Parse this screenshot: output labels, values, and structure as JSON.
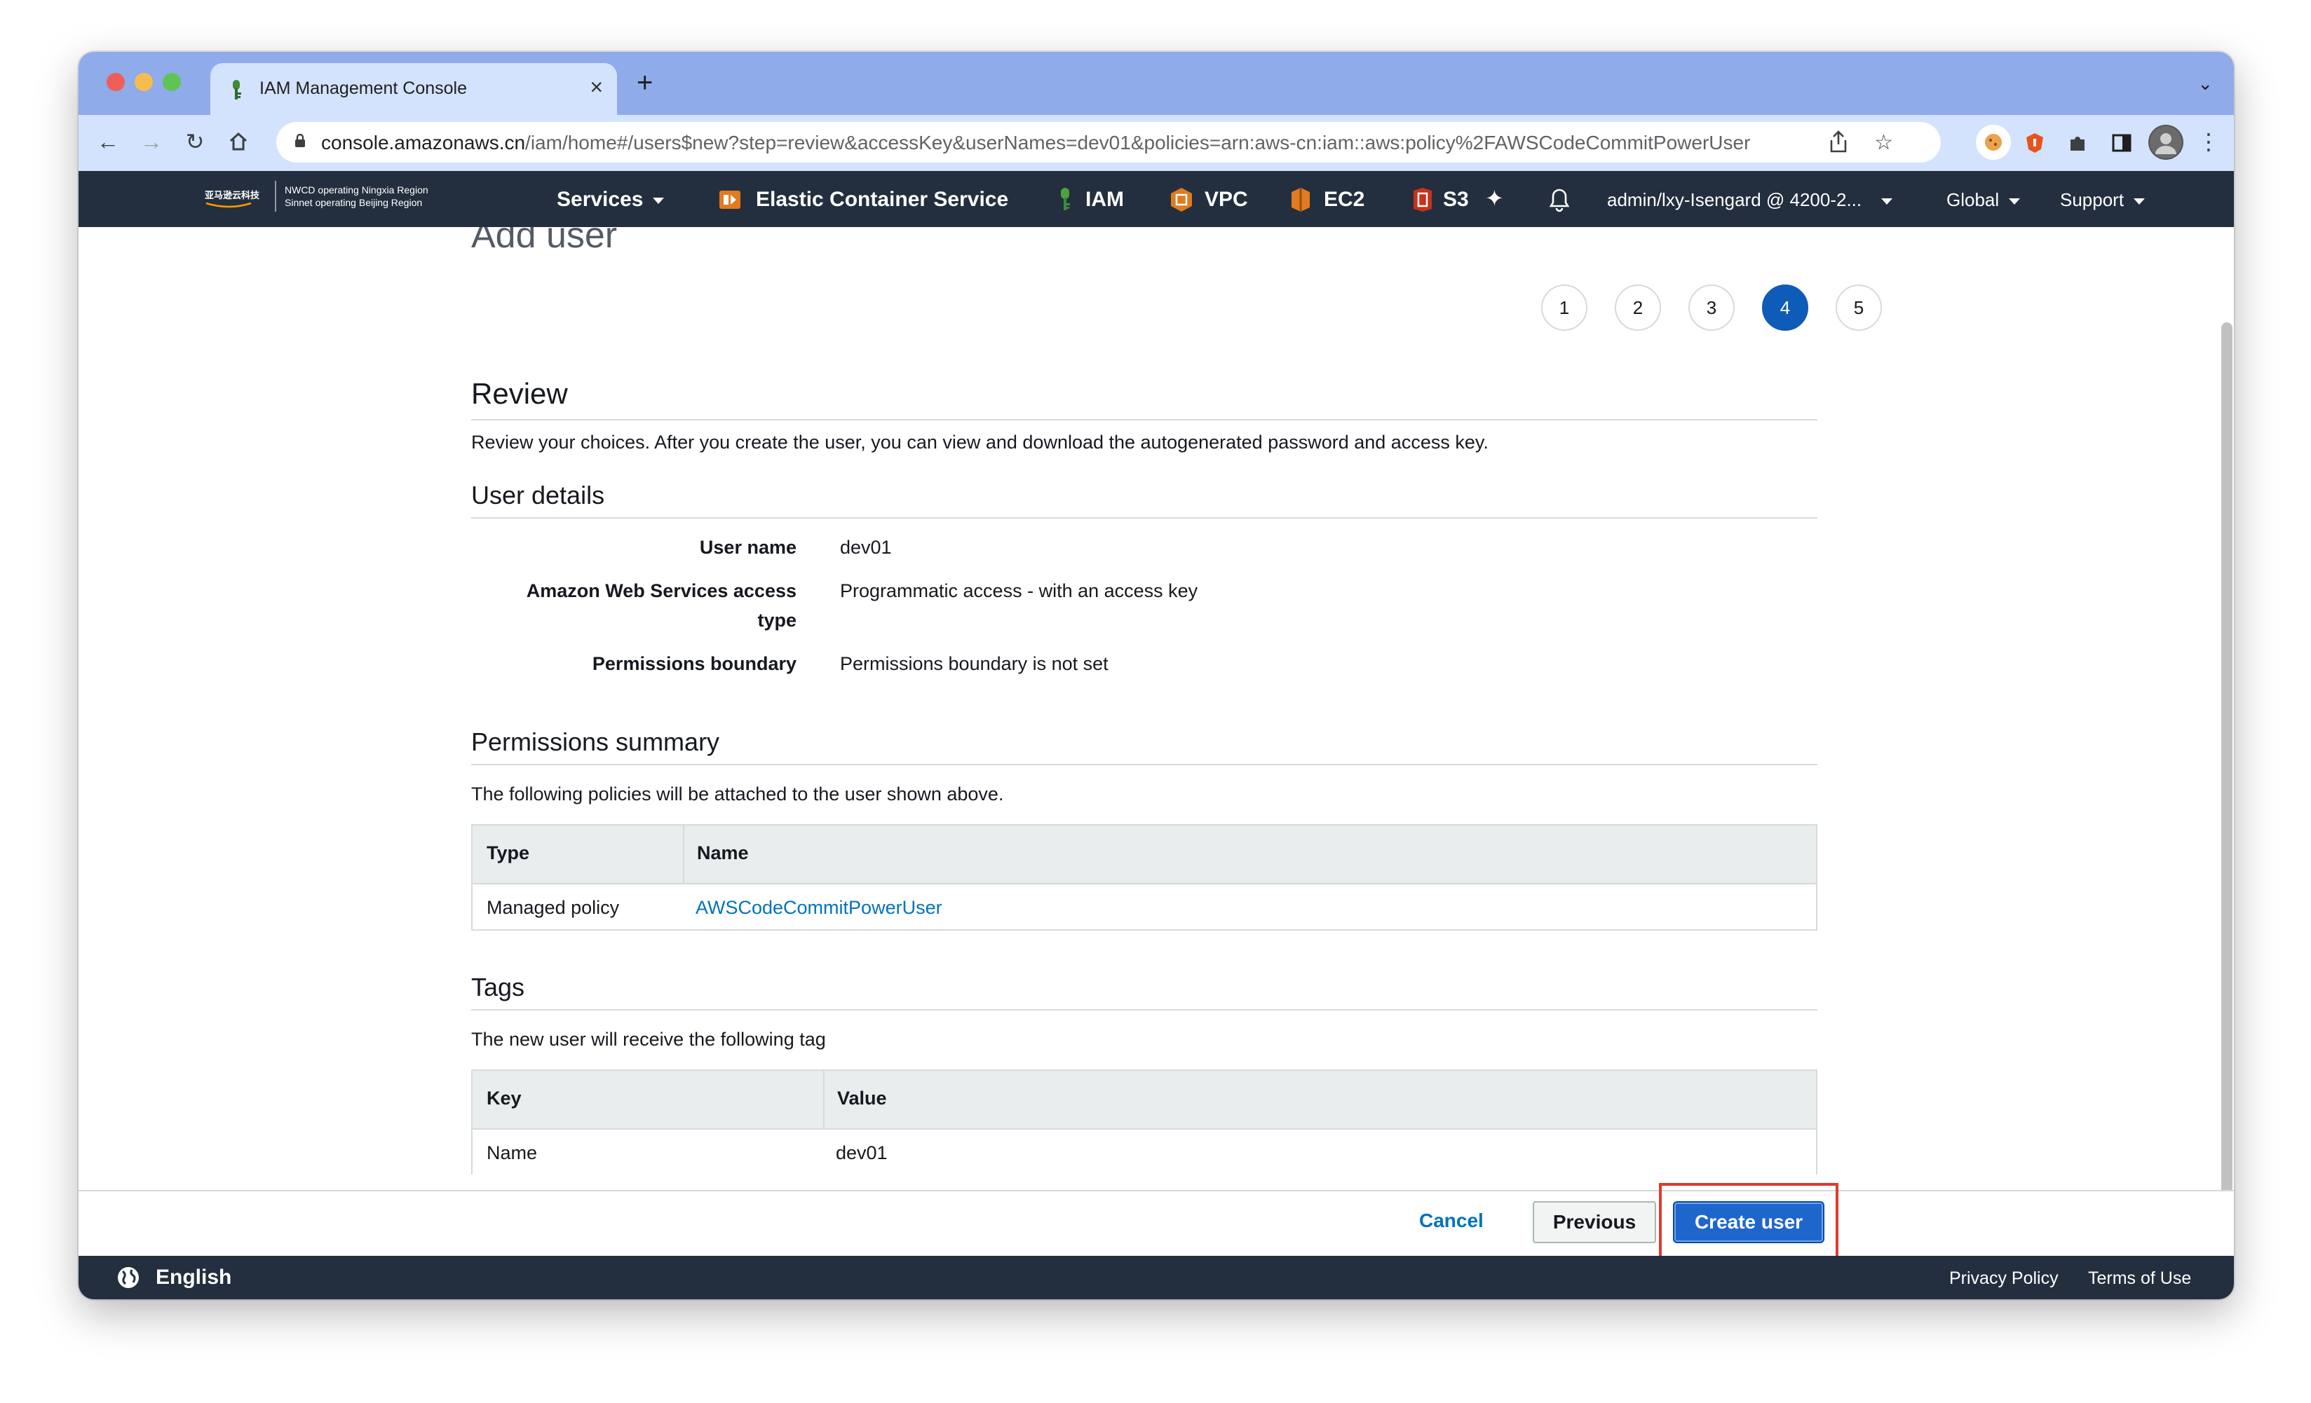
{
  "browser": {
    "tab_title": "IAM Management Console",
    "tab_close": "×",
    "new_tab": "+",
    "url_host": "console.amazonaws.cn",
    "url_path": "/iam/home#/users$new?step=review&accessKey&userNames=dev01&policies=arn:aws-cn:iam::aws:policy%2FAWSCodeCommitPowerUser"
  },
  "aws_header": {
    "logo_line1": "NWCD operating Ningxia Region",
    "logo_line2": "Sinnet operating Beijing Region",
    "logo_cn": "亚马逊云科技",
    "services": "Services",
    "favorites": [
      "Elastic Container Service",
      "IAM",
      "VPC",
      "EC2",
      "S3"
    ],
    "account": "admin/lxy-Isengard @ 4200-2...",
    "region": "Global",
    "support": "Support"
  },
  "page": {
    "title": "Add user",
    "steps": [
      "1",
      "2",
      "3",
      "4",
      "5"
    ],
    "active_step": "4"
  },
  "review": {
    "heading": "Review",
    "intro": "Review your choices. After you create the user, you can view and download the autogenerated password and access key."
  },
  "user_details": {
    "heading": "User details",
    "rows": [
      {
        "label": "User name",
        "value": "dev01"
      },
      {
        "label": "Amazon Web Services access type",
        "value": "Programmatic access - with an access key"
      },
      {
        "label": "Permissions boundary",
        "value": "Permissions boundary is not set"
      }
    ]
  },
  "permissions": {
    "heading": "Permissions summary",
    "intro": "The following policies will be attached to the user shown above.",
    "columns": [
      "Type",
      "Name"
    ],
    "rows": [
      {
        "type": "Managed policy",
        "name": "AWSCodeCommitPowerUser"
      }
    ]
  },
  "tags": {
    "heading": "Tags",
    "intro": "The new user will receive the following tag",
    "columns": [
      "Key",
      "Value"
    ],
    "rows": [
      {
        "key": "Name",
        "value": "dev01"
      }
    ]
  },
  "actions": {
    "cancel": "Cancel",
    "previous": "Previous",
    "create": "Create user"
  },
  "footer": {
    "language": "English",
    "privacy": "Privacy Policy",
    "terms": "Terms of Use"
  },
  "colors": {
    "aws_header_bg": "#232f3e",
    "primary_button": "#1f66cc",
    "link": "#0073bb",
    "highlight_box": "#e03a2f",
    "active_step": "#0f5bb8"
  }
}
